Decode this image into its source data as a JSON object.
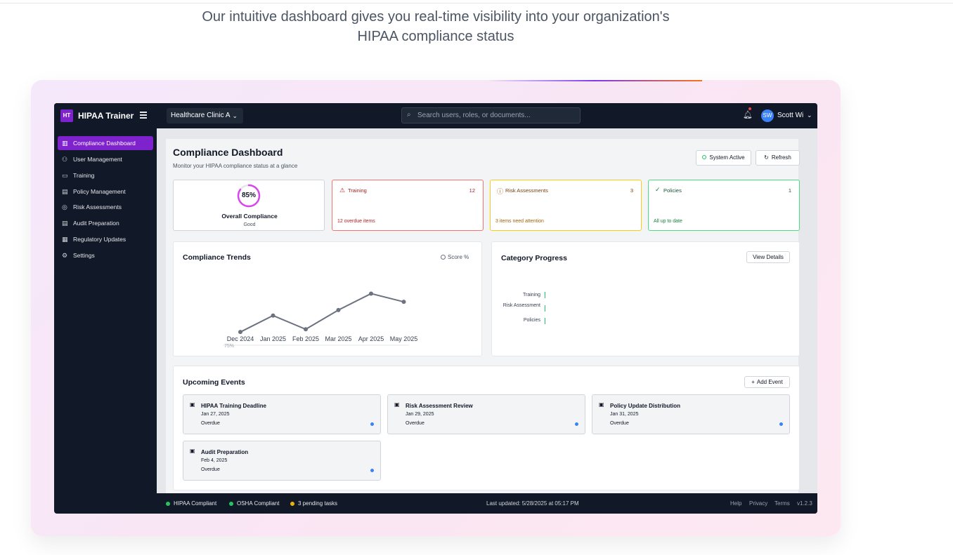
{
  "hero": {
    "line1": "Our intuitive dashboard gives you real-time visibility into your organization's",
    "line2": "HIPAA compliance status"
  },
  "topbar": {
    "logo_text": "HT",
    "app_name": "HIPAA Trainer",
    "org_select": "Healthcare Clinic A",
    "search_placeholder": "Search users, roles, or documents...",
    "user_initials": "SW",
    "user_name": "Scott Wi"
  },
  "sidebar": {
    "items": [
      {
        "label": "Compliance Dashboard",
        "icon": "bar-chart-icon",
        "active": true
      },
      {
        "label": "User Management",
        "icon": "users-icon"
      },
      {
        "label": "Training",
        "icon": "book-icon"
      },
      {
        "label": "Policy Management",
        "icon": "document-icon"
      },
      {
        "label": "Risk Assessments",
        "icon": "check-circle-icon"
      },
      {
        "label": "Audit Preparation",
        "icon": "file-icon"
      },
      {
        "label": "Regulatory Updates",
        "icon": "news-icon"
      },
      {
        "label": "Settings",
        "icon": "gear-icon"
      }
    ]
  },
  "dashboard": {
    "title": "Compliance Dashboard",
    "subtitle": "Monitor your HIPAA compliance status at a glance",
    "system_status": "System Active",
    "refresh_label": "Refresh"
  },
  "stats": {
    "overall": {
      "value": "85%",
      "percent": 85,
      "label": "Overall Compliance",
      "status": "Good"
    },
    "training": {
      "label": "Training",
      "count": "12",
      "note": "12 overdue items",
      "color": "#b91c1c"
    },
    "risk": {
      "label": "Risk Assessments",
      "count": "3",
      "note": "3 items need attention",
      "color": "#a16207"
    },
    "policies": {
      "label": "Policies",
      "count": "1",
      "note": "All up to date",
      "color": "#15803d"
    }
  },
  "trends": {
    "title": "Compliance Trends",
    "legend": "Score %",
    "partial_tick": "75%"
  },
  "chart_data": {
    "type": "line",
    "title": "Compliance Trends",
    "x": [
      "Dec 2024",
      "Jan 2025",
      "Feb 2025",
      "Mar 2025",
      "Apr 2025",
      "May 2025"
    ],
    "series": [
      {
        "name": "Score %",
        "values": [
          76,
          82,
          77,
          84,
          90,
          87
        ]
      }
    ],
    "ylim": [
      74,
      96
    ],
    "grid": false,
    "legend": "top-right"
  },
  "category_progress": {
    "title": "Category Progress",
    "view_details": "View Details",
    "categories": [
      "Training",
      "Risk Assessment",
      "Policies"
    ]
  },
  "events": {
    "title": "Upcoming Events",
    "add_label": "Add Event",
    "items": [
      {
        "title": "HIPAA Training Deadline",
        "date": "Jan 27, 2025",
        "status": "Overdue"
      },
      {
        "title": "Risk Assessment Review",
        "date": "Jan 29, 2025",
        "status": "Overdue"
      },
      {
        "title": "Policy Update Distribution",
        "date": "Jan 31, 2025",
        "status": "Overdue"
      },
      {
        "title": "Audit Preparation",
        "date": "Feb 4, 2025",
        "status": "Overdue"
      }
    ]
  },
  "footer": {
    "hipaa": "HIPAA Compliant",
    "osha": "OSHA Compliant",
    "pending": "3 pending tasks",
    "updated": "Last updated: 5/28/2025 at 05:17 PM",
    "links": [
      "Help",
      "Privacy",
      "Terms"
    ],
    "version": "v1.2.3"
  },
  "colors": {
    "accent": "#7e22ce",
    "ring": "#d946ef",
    "success": "#22c55e",
    "warning": "#eab308",
    "info": "#3b82f6"
  }
}
